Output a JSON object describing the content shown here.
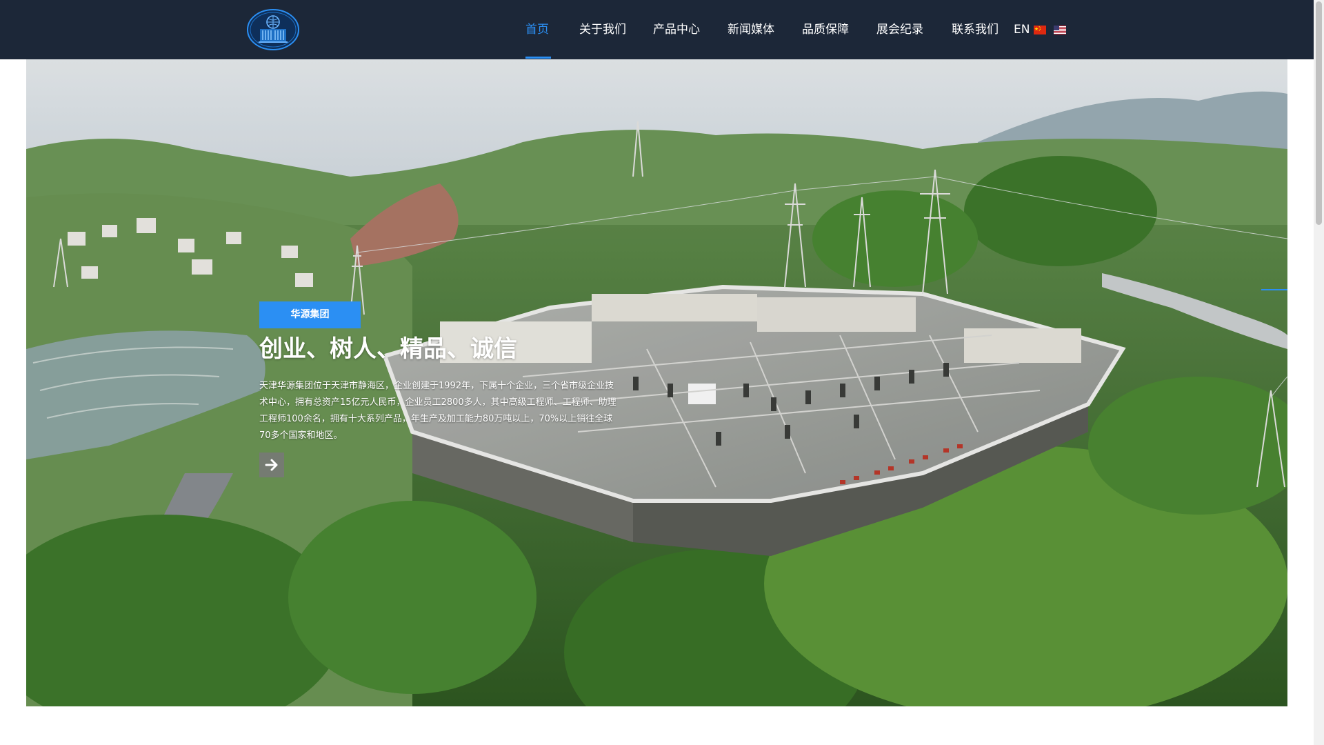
{
  "header": {
    "nav": [
      {
        "label": "首页",
        "active": true
      },
      {
        "label": "关于我们",
        "active": false
      },
      {
        "label": "产品中心",
        "active": false
      },
      {
        "label": "新闻媒体",
        "active": false
      },
      {
        "label": "品质保障",
        "active": false
      },
      {
        "label": "展会纪录",
        "active": false
      },
      {
        "label": "联系我们",
        "active": false
      }
    ],
    "lang_label": "EN",
    "flags": [
      "china-flag-icon",
      "us-flag-icon"
    ]
  },
  "hero": {
    "tag": "华源集团",
    "title": "创业、树人、精品、诚信",
    "description": "天津华源集团位于天津市静海区，企业创建于1992年，下属十个企业，三个省市级企业技术中心，拥有总资产15亿元人民币，企业员工2800多人，其中高级工程师、工程师、助理工程师100余名，拥有十大系列产品，年生产及加工能力80万吨以上，70%以上销往全球70多个国家和地区。",
    "arrow_icon": "arrow-right-icon"
  },
  "colors": {
    "header_bg": "#1c2738",
    "accent": "#2b8ff3",
    "nav_text": "#ffffff"
  }
}
